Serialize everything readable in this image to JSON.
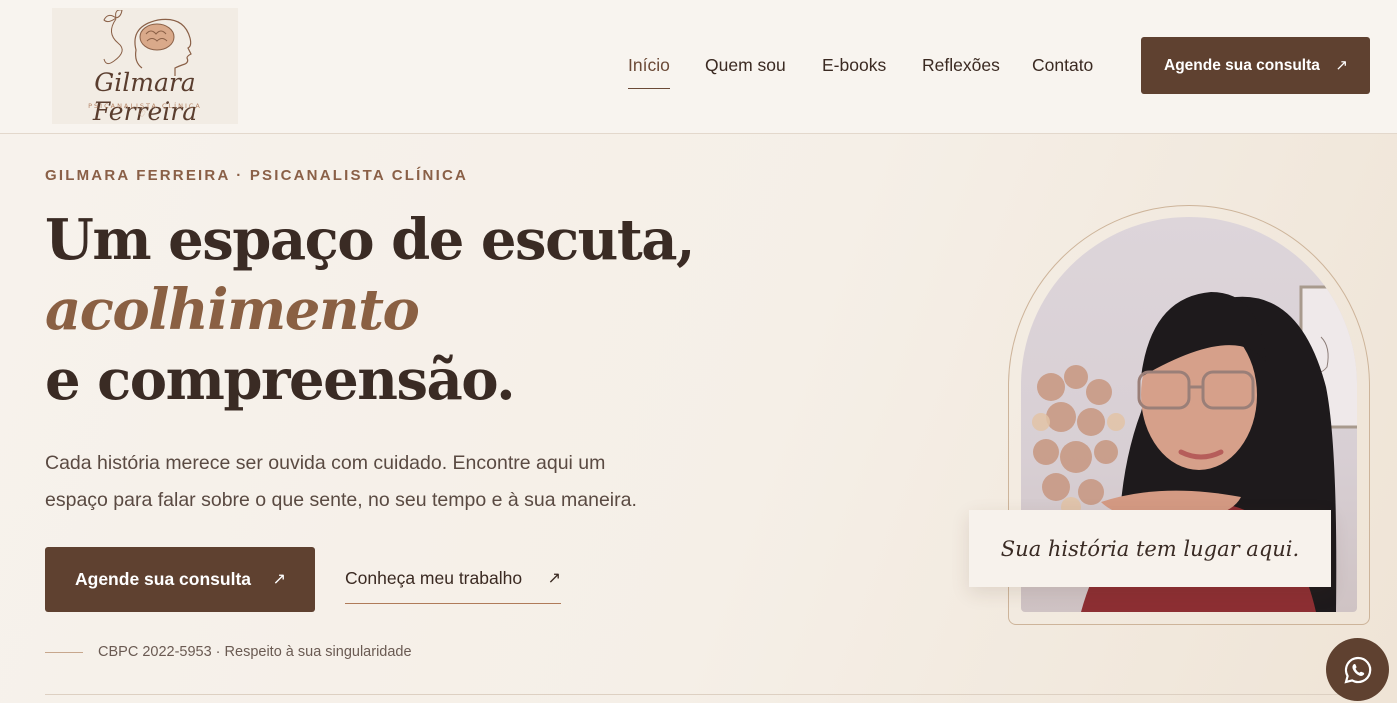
{
  "header": {
    "logo": {
      "name": "Gilmara Ferreira",
      "subtitle": "PSICANALISTA CLÍNICA",
      "icon": "head-brain-butterfly-icon"
    },
    "nav": [
      {
        "label": "Início",
        "active": true
      },
      {
        "label": "Quem sou",
        "active": false
      },
      {
        "label": "E-books",
        "active": false
      },
      {
        "label": "Reflexões",
        "active": false
      },
      {
        "label": "Contato",
        "active": false
      }
    ],
    "cta": {
      "label": "Agende sua consulta",
      "icon": "arrow-up-right-icon"
    }
  },
  "hero": {
    "eyebrow": "GILMARA FERREIRA · PSICANALISTA CLÍNICA",
    "headline": {
      "line1": "Um espaço de escuta,",
      "line2": "acolhimento",
      "line3": "e compreensão."
    },
    "lead": "Cada história merece ser ouvida com cuidado. Encontre aqui um espaço para falar sobre o que sente, no seu tempo e à sua maneira.",
    "primary_cta": "Agende sua consulta",
    "secondary_cta": "Conheça meu trabalho",
    "registration": "CBPC 2022-5953 · Respeito à sua singularidade",
    "quote": "Sua história tem lugar aqui."
  },
  "whatsapp": {
    "icon": "whatsapp-icon"
  },
  "colors": {
    "brand": "#5f4130",
    "accent": "#8a6043",
    "background": "#f6f1eb"
  }
}
